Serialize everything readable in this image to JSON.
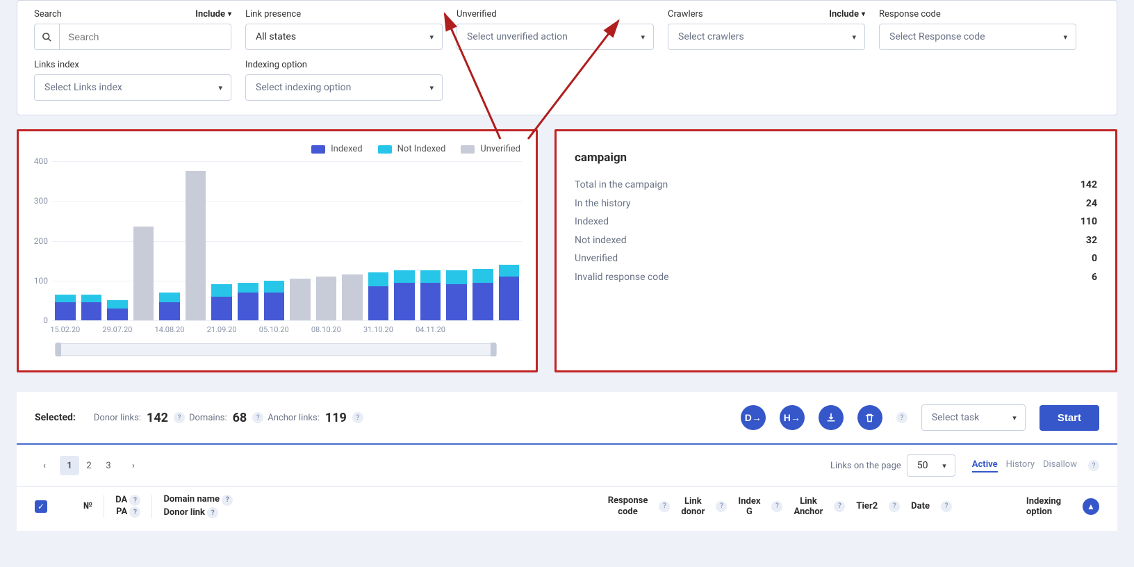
{
  "filters": {
    "search": {
      "label": "Search",
      "include": "Include",
      "placeholder": "Search"
    },
    "link_presence": {
      "label": "Link presence",
      "placeholder": "All states"
    },
    "unverified": {
      "label": "Unverified",
      "placeholder": "Select unverified action"
    },
    "crawlers": {
      "label": "Crawlers",
      "include": "Include",
      "placeholder": "Select crawlers"
    },
    "response_code": {
      "label": "Response code",
      "placeholder": "Select Response code"
    },
    "links_index": {
      "label": "Links index",
      "placeholder": "Select Links index"
    },
    "indexing_option": {
      "label": "Indexing option",
      "placeholder": "Select indexing option"
    }
  },
  "legend": {
    "indexed": "Indexed",
    "not_indexed": "Not Indexed",
    "unverified": "Unverified"
  },
  "colors": {
    "indexed": "#4559d6",
    "not_indexed": "#27c6e9",
    "unverified": "#c8ccd8",
    "accent": "#3557c9",
    "annot": "#b01e1e"
  },
  "chart_data": {
    "type": "bar",
    "ylabel": "",
    "ylim": [
      0,
      400
    ],
    "yticks": [
      0,
      100,
      200,
      300,
      400
    ],
    "categories": [
      "15.02.20",
      "",
      "29.07.20",
      "",
      "14.08.20",
      "",
      "21.09.20",
      "",
      "05.10.20",
      "",
      "08.10.20",
      "",
      "31.10.20",
      "",
      "04.11.20",
      "",
      ""
    ],
    "series": [
      {
        "name": "Indexed",
        "values": [
          45,
          45,
          30,
          45,
          45,
          55,
          60,
          70,
          70,
          0,
          0,
          0,
          85,
          95,
          95,
          90,
          95,
          110
        ]
      },
      {
        "name": "Not Indexed",
        "values": [
          20,
          20,
          20,
          20,
          25,
          20,
          30,
          25,
          30,
          0,
          0,
          0,
          35,
          30,
          30,
          35,
          35,
          30
        ]
      },
      {
        "name": "Unverified",
        "values": [
          0,
          0,
          0,
          235,
          0,
          375,
          0,
          0,
          0,
          105,
          110,
          115,
          0,
          0,
          0,
          0,
          0,
          0
        ]
      }
    ],
    "xlabels_visible": [
      "15.02.20",
      "29.07.20",
      "14.08.20",
      "21.09.20",
      "05.10.20",
      "08.10.20",
      "31.10.20",
      "04.11.20"
    ]
  },
  "campaign": {
    "title": "campaign",
    "rows": [
      {
        "label": "Total in the campaign",
        "value": "142"
      },
      {
        "label": "In the history",
        "value": "24"
      },
      {
        "label": "Indexed",
        "value": "110"
      },
      {
        "label": "Not indexed",
        "value": "32"
      },
      {
        "label": "Unverified",
        "value": "0"
      },
      {
        "label": "Invalid response code",
        "value": "6"
      }
    ]
  },
  "selection": {
    "label": "Selected:",
    "stats": [
      {
        "label": "Donor links:",
        "value": "142"
      },
      {
        "label": "Domains:",
        "value": "68"
      },
      {
        "label": "Anchor links:",
        "value": "119"
      }
    ],
    "task_placeholder": "Select task",
    "start": "Start"
  },
  "pager": {
    "pages": [
      "1",
      "2",
      "3"
    ],
    "active": "1",
    "links_on_page_label": "Links on the page",
    "links_on_page_value": "50",
    "tabs": {
      "active": "Active",
      "history": "History",
      "disallow": "Disallow"
    }
  },
  "table": {
    "cols": {
      "num": "№",
      "da": "DA",
      "pa": "PA",
      "domain_name": "Domain name",
      "donor_link": "Donor link",
      "response_code": "Response code",
      "link_donor": "Link donor",
      "index_g": "Index G",
      "link_anchor": "Link Anchor",
      "tier2": "Tier2",
      "date": "Date",
      "indexing_option": "Indexing option"
    }
  }
}
